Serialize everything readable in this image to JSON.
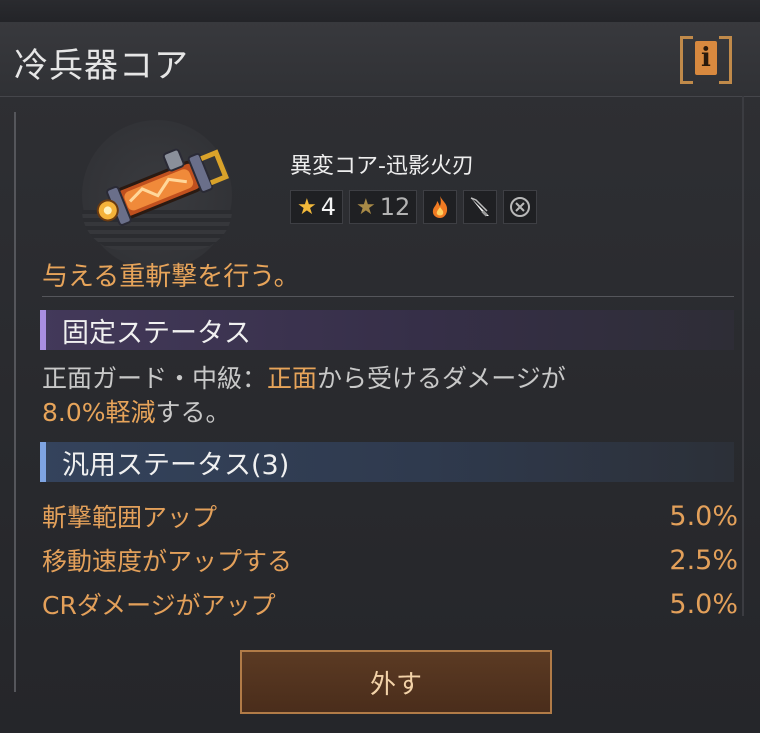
{
  "window": {
    "title": "冷兵器コア"
  },
  "item": {
    "name": "異変コア-迅影火刃",
    "rarity_stars": "4",
    "level": "12",
    "icons": [
      "fire-icon",
      "blade-icon",
      "cooldown-icon"
    ]
  },
  "description": "与える重斬撃を行う。",
  "fixed_status": {
    "header": "固定ステータス",
    "text_part1": "正面ガード・中級：",
    "text_highlight": "正面",
    "text_part2": "から受けるダメージが",
    "text_value": "8.0%軽減",
    "text_part3": "する。"
  },
  "general_status": {
    "header": "汎用ステータス(3)",
    "stats": [
      {
        "name": "斬撃範囲アップ",
        "value": "5.0%"
      },
      {
        "name": "移動速度がアップする",
        "value": "2.5%"
      },
      {
        "name": "CRダメージがアップ",
        "value": "5.0%"
      }
    ]
  },
  "actions": {
    "remove_label": "外す"
  },
  "colors": {
    "accent": "#e7a45a",
    "fixed_bar": "#a98ee0",
    "general_bar": "#7ea4e2",
    "button_border": "#b17b47"
  }
}
